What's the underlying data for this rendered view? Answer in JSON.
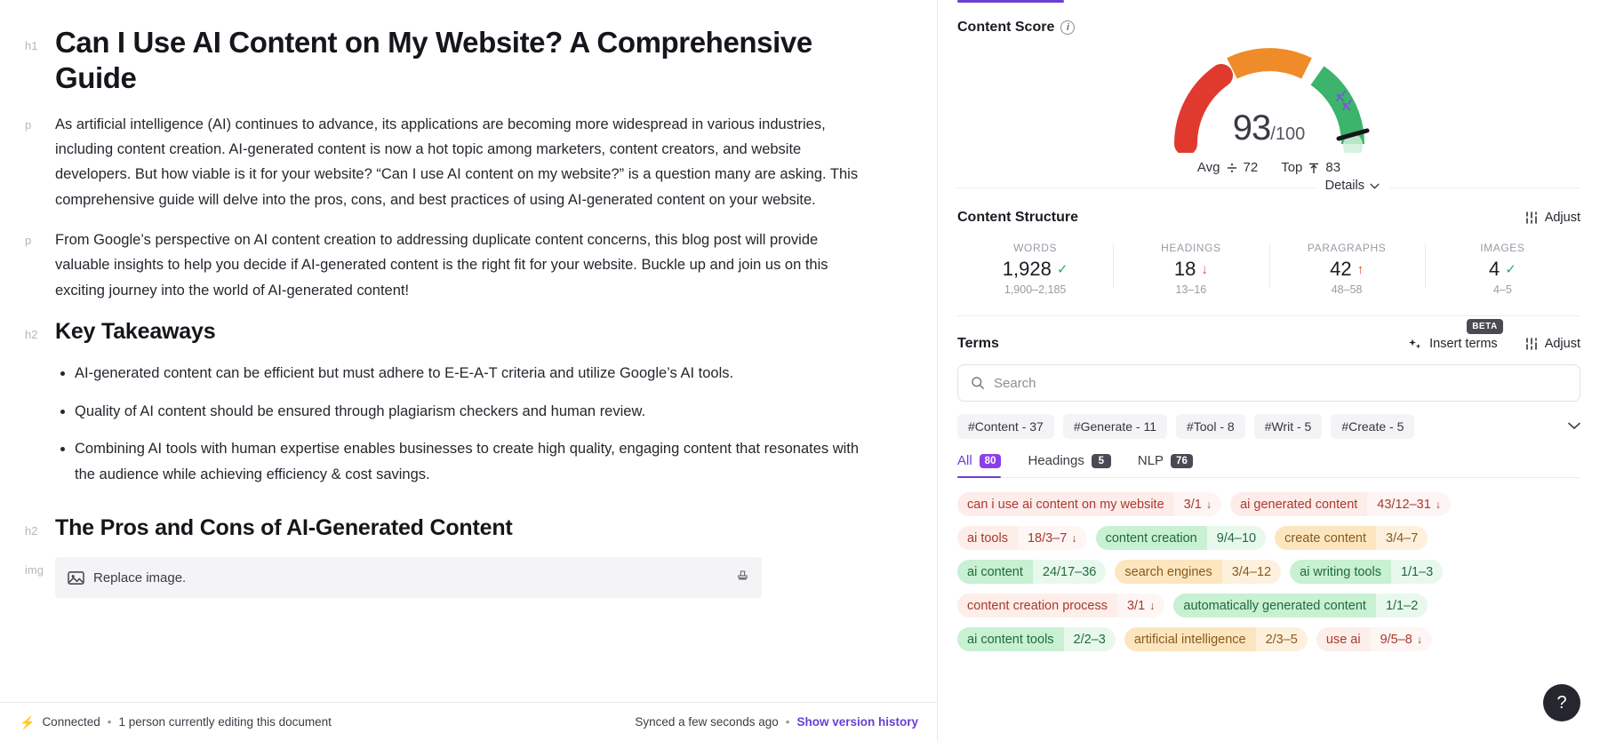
{
  "editor": {
    "blocks": [
      {
        "tag": "h1",
        "type": "h1",
        "text": "Can I Use AI Content on My Website? A Comprehensive Guide"
      },
      {
        "tag": "p",
        "type": "p",
        "text": "As artificial intelligence (AI) continues to advance, its applications are becoming more widespread in various industries, including content creation. AI-generated content is now a hot topic among marketers, content creators, and website developers. But how viable is it for your website? “Can I use AI content on my website?” is a question many are asking. This comprehensive guide will delve into the pros, cons, and best practices of using AI-generated content on your website."
      },
      {
        "tag": "p",
        "type": "p",
        "text": "From Google’s perspective on AI content creation to addressing duplicate content concerns, this blog post will provide valuable insights to help you decide if AI-generated content is the right fit for your website. Buckle up and join us on this exciting journey into the world of AI-generated content!"
      },
      {
        "tag": "h2",
        "type": "h2",
        "text": "Key Takeaways"
      },
      {
        "tag": "",
        "type": "ul",
        "items": [
          "AI-generated content can be efficient but must adhere to E-E-A-T criteria and utilize Google’s AI tools.",
          "Quality of AI content should be ensured through plagiarism checkers and human review.",
          "Combining AI tools with human expertise enables businesses to create high quality, engaging content that resonates with the audience while achieving efficiency & cost savings."
        ]
      },
      {
        "tag": "h2",
        "type": "h2",
        "text": "The Pros and Cons of AI-Generated Content"
      },
      {
        "tag": "img",
        "type": "img",
        "text": "Replace image."
      }
    ],
    "footer": {
      "connected": "Connected",
      "separator": "•",
      "editing_status": "1 person currently editing this document",
      "synced": "Synced a few seconds ago",
      "version_link": "Show version history"
    }
  },
  "panel": {
    "content_score": {
      "title": "Content Score",
      "score": "93",
      "denominator": "/100",
      "avg_label": "Avg",
      "avg_value": "72",
      "top_label": "Top",
      "top_value": "83",
      "details_label": "Details"
    },
    "content_structure": {
      "title": "Content Structure",
      "adjust_label": "Adjust",
      "stats": [
        {
          "label": "WORDS",
          "value": "1,928",
          "indicator": "check",
          "range": "1,900–2,185"
        },
        {
          "label": "HEADINGS",
          "value": "18",
          "indicator": "down",
          "range": "13–16"
        },
        {
          "label": "PARAGRAPHS",
          "value": "42",
          "indicator": "up",
          "range": "48–58"
        },
        {
          "label": "IMAGES",
          "value": "4",
          "indicator": "check",
          "range": "4–5"
        }
      ]
    },
    "terms": {
      "title": "Terms",
      "insert_terms_label": "Insert terms",
      "beta_badge": "BETA",
      "adjust_label": "Adjust",
      "search_placeholder": "Search",
      "hash_chips": [
        "#Content - 37",
        "#Generate - 11",
        "#Tool - 8",
        "#Writ - 5",
        "#Create - 5"
      ],
      "tabs": [
        {
          "label": "All",
          "count": "80",
          "active": true
        },
        {
          "label": "Headings",
          "count": "5",
          "active": false
        },
        {
          "label": "NLP",
          "count": "76",
          "active": false
        }
      ],
      "items": [
        {
          "name": "can i use ai content on my website",
          "count": "3/1",
          "arrow": "down",
          "color": "c-red"
        },
        {
          "name": "ai generated content",
          "count": "43/12–31",
          "arrow": "down",
          "color": "c-red"
        },
        {
          "name": "ai tools",
          "count": "18/3–7",
          "arrow": "down",
          "color": "c-lightred"
        },
        {
          "name": "content creation",
          "count": "9/4–10",
          "arrow": "",
          "color": "c-green"
        },
        {
          "name": "create content",
          "count": "3/4–7",
          "arrow": "",
          "color": "c-orange"
        },
        {
          "name": "ai content",
          "count": "24/17–36",
          "arrow": "",
          "color": "c-green"
        },
        {
          "name": "search engines",
          "count": "3/4–12",
          "arrow": "",
          "color": "c-orange"
        },
        {
          "name": "ai writing tools",
          "count": "1/1–3",
          "arrow": "",
          "color": "c-green"
        },
        {
          "name": "content creation process",
          "count": "3/1",
          "arrow": "down",
          "color": "c-lightred"
        },
        {
          "name": "automatically generated content",
          "count": "1/1–2",
          "arrow": "",
          "color": "c-green"
        },
        {
          "name": "ai content tools",
          "count": "2/2–3",
          "arrow": "",
          "color": "c-green"
        },
        {
          "name": "artificial intelligence",
          "count": "2/3–5",
          "arrow": "",
          "color": "c-orange"
        },
        {
          "name": "use ai",
          "count": "9/5–8",
          "arrow": "down",
          "color": "c-lightred"
        }
      ]
    },
    "help_label": "?"
  },
  "colors": {
    "accent": "#6b3fd4",
    "gauge_red": "#e03a2f",
    "gauge_orange": "#ef8b28",
    "gauge_green": "#3cb46b",
    "good": "#35a35f",
    "bad": "#e5483c"
  }
}
